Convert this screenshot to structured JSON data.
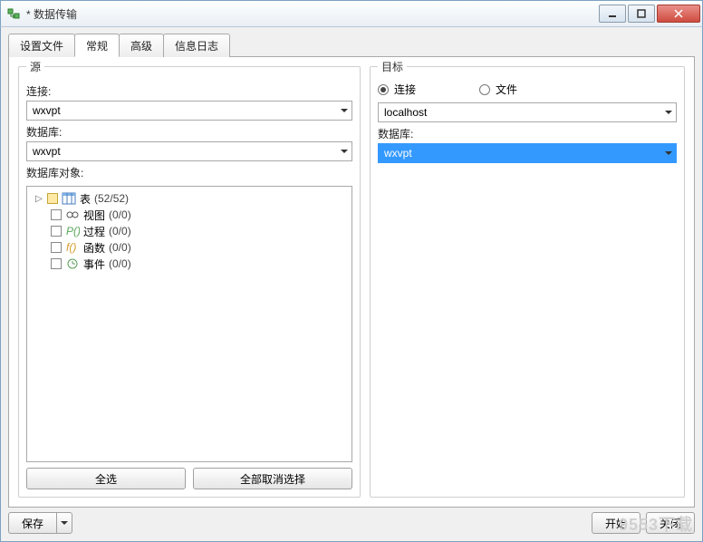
{
  "window": {
    "title": "* 数据传输"
  },
  "tabs": {
    "set_file": "设置文件",
    "general": "常规",
    "advanced": "高级",
    "log": "信息日志",
    "active": "general"
  },
  "source": {
    "legend": "源",
    "conn_label": "连接:",
    "conn_value": "wxvpt",
    "db_label": "数据库:",
    "db_value": "wxvpt",
    "objects_label": "数据库对象:",
    "tree": {
      "tables": {
        "label": "表",
        "count": "(52/52)"
      },
      "views": {
        "label": "视图",
        "count": "(0/0)"
      },
      "procs": {
        "label": "过程",
        "count": "(0/0)"
      },
      "funcs": {
        "label": "函数",
        "count": "(0/0)"
      },
      "events": {
        "label": "事件",
        "count": "(0/0)"
      }
    },
    "select_all": "全选",
    "deselect_all": "全部取消选择"
  },
  "target": {
    "legend": "目标",
    "radio_conn": "连接",
    "radio_file": "文件",
    "selected_radio": "conn",
    "conn_value": "localhost",
    "db_label": "数据库:",
    "db_value": "wxvpt"
  },
  "footer": {
    "save": "保存",
    "start": "开始",
    "close": "关闭"
  },
  "watermark": "9553下载"
}
